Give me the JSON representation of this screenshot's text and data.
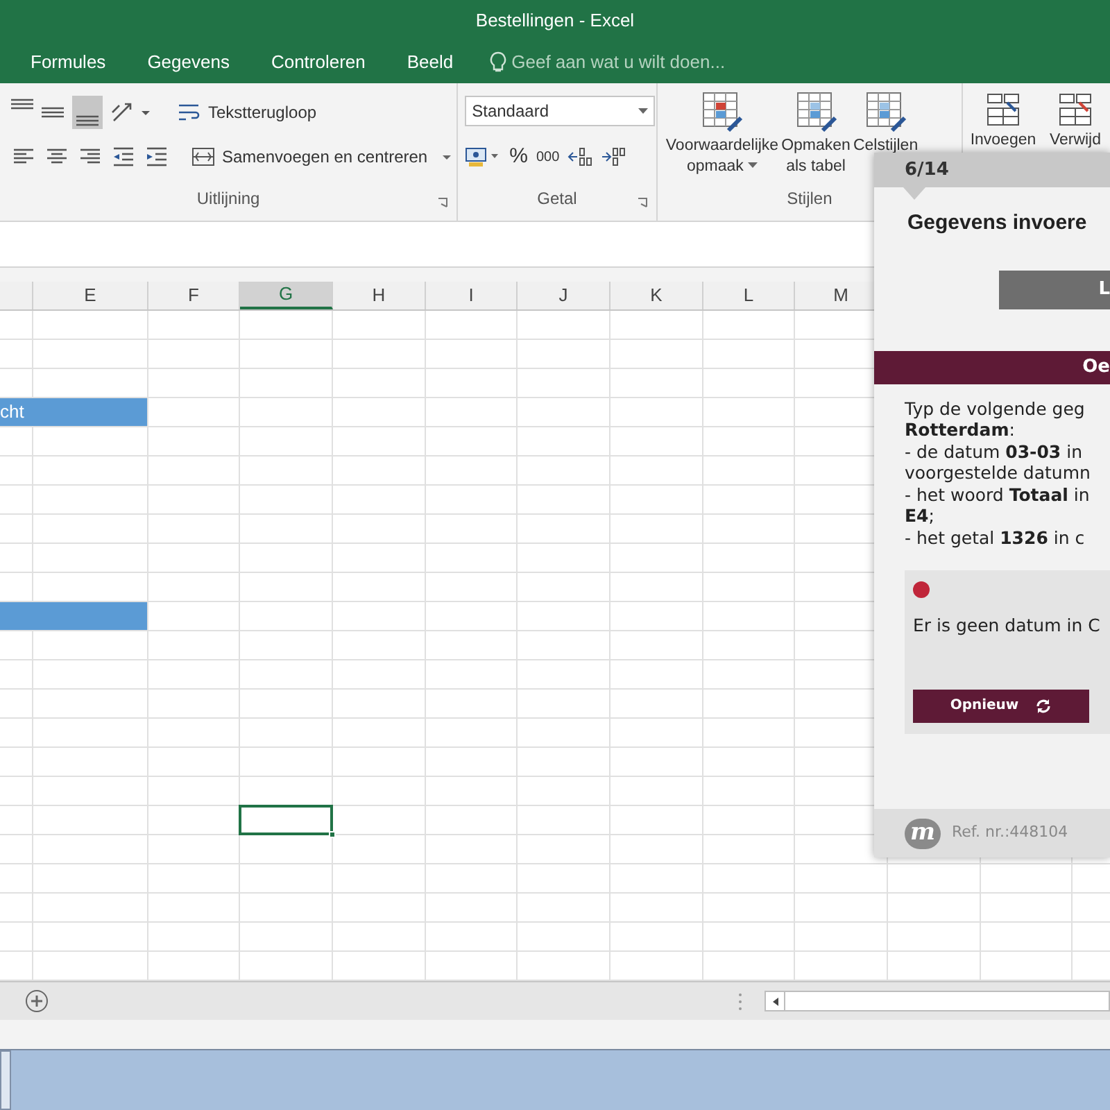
{
  "window": {
    "title": "Bestellingen - Excel"
  },
  "menu_tabs": [
    {
      "label": "Formules",
      "selected": false
    },
    {
      "label": "Gegevens",
      "selected": false
    },
    {
      "label": "Controleren",
      "selected": false
    },
    {
      "label": "Beeld",
      "selected": false
    }
  ],
  "tell_me": {
    "placeholder": "Geef aan wat u wilt doen..."
  },
  "ribbon": {
    "groups": [
      {
        "kind": "alignment",
        "label": "Uitlijning",
        "wrap_text": "Tekstterugloop",
        "merge": "Samenvoegen en centreren",
        "bottom_align_selected": true
      },
      {
        "kind": "number",
        "label": "Getal",
        "format": "Standaard",
        "percent": "%",
        "thousands": "000"
      },
      {
        "kind": "styles",
        "label": "Stijlen",
        "buttons": [
          {
            "lines": [
              "Voorwaardelijke",
              "opmaak"
            ],
            "dropdown": true
          },
          {
            "lines": [
              "Opmaken",
              "als tabel"
            ],
            "dropdown": false
          },
          {
            "lines": [
              "Celstijlen"
            ],
            "dropdown": false
          }
        ]
      },
      {
        "kind": "cells",
        "buttons": [
          {
            "lines": [
              "Invoegen"
            ],
            "dropdown": false
          },
          {
            "lines": [
              "Verwijd"
            ],
            "dropdown": false
          }
        ]
      }
    ]
  },
  "sheet": {
    "columns": [
      {
        "label": "E",
        "selected": false
      },
      {
        "label": "F",
        "selected": false
      },
      {
        "label": "G",
        "selected": true
      },
      {
        "label": "H",
        "selected": false
      },
      {
        "label": "I",
        "selected": false
      },
      {
        "label": "J",
        "selected": false
      },
      {
        "label": "K",
        "selected": false
      },
      {
        "label": "L",
        "selected": false
      },
      {
        "label": "M",
        "selected": false
      }
    ],
    "rows": [
      {
        "highlighted": false,
        "active": false
      },
      {
        "highlighted": false,
        "active": false
      },
      {
        "highlighted": false,
        "active": false
      },
      {
        "highlighted": true,
        "active": false,
        "text": "cht"
      },
      {
        "highlighted": false,
        "active": false
      },
      {
        "highlighted": false,
        "active": false
      },
      {
        "highlighted": false,
        "active": false
      },
      {
        "highlighted": false,
        "active": false
      },
      {
        "highlighted": false,
        "active": false
      },
      {
        "highlighted": false,
        "active": false
      },
      {
        "highlighted": true,
        "active": false
      },
      {
        "highlighted": false,
        "active": false
      },
      {
        "highlighted": false,
        "active": false
      },
      {
        "highlighted": false,
        "active": false
      },
      {
        "highlighted": false,
        "active": false
      },
      {
        "highlighted": false,
        "active": false
      },
      {
        "highlighted": false,
        "active": false
      },
      {
        "highlighted": false,
        "active": true
      },
      {
        "highlighted": false,
        "active": false
      },
      {
        "highlighted": false,
        "active": false
      },
      {
        "highlighted": false,
        "active": false
      },
      {
        "highlighted": false,
        "active": false
      },
      {
        "highlighted": false,
        "active": false
      }
    ]
  },
  "tutorial_panel": {
    "step": "6/14",
    "title": "Gegevens invoere",
    "top_button": "L",
    "section_bar": "Oe",
    "instructions": [
      "Typ de volgende geg",
      "**Rotterdam**:",
      "- de datum **03-03** in",
      "voorgestelde datumn",
      "- het woord **Totaal** in",
      "**E4**;",
      "- het getal **1326** in c"
    ],
    "feedback": {
      "color": "#c0263a",
      "message": "Er is geen datum in C",
      "button": "Opnieuw"
    },
    "logo": "m",
    "reference": "Ref. nr.:448104"
  }
}
